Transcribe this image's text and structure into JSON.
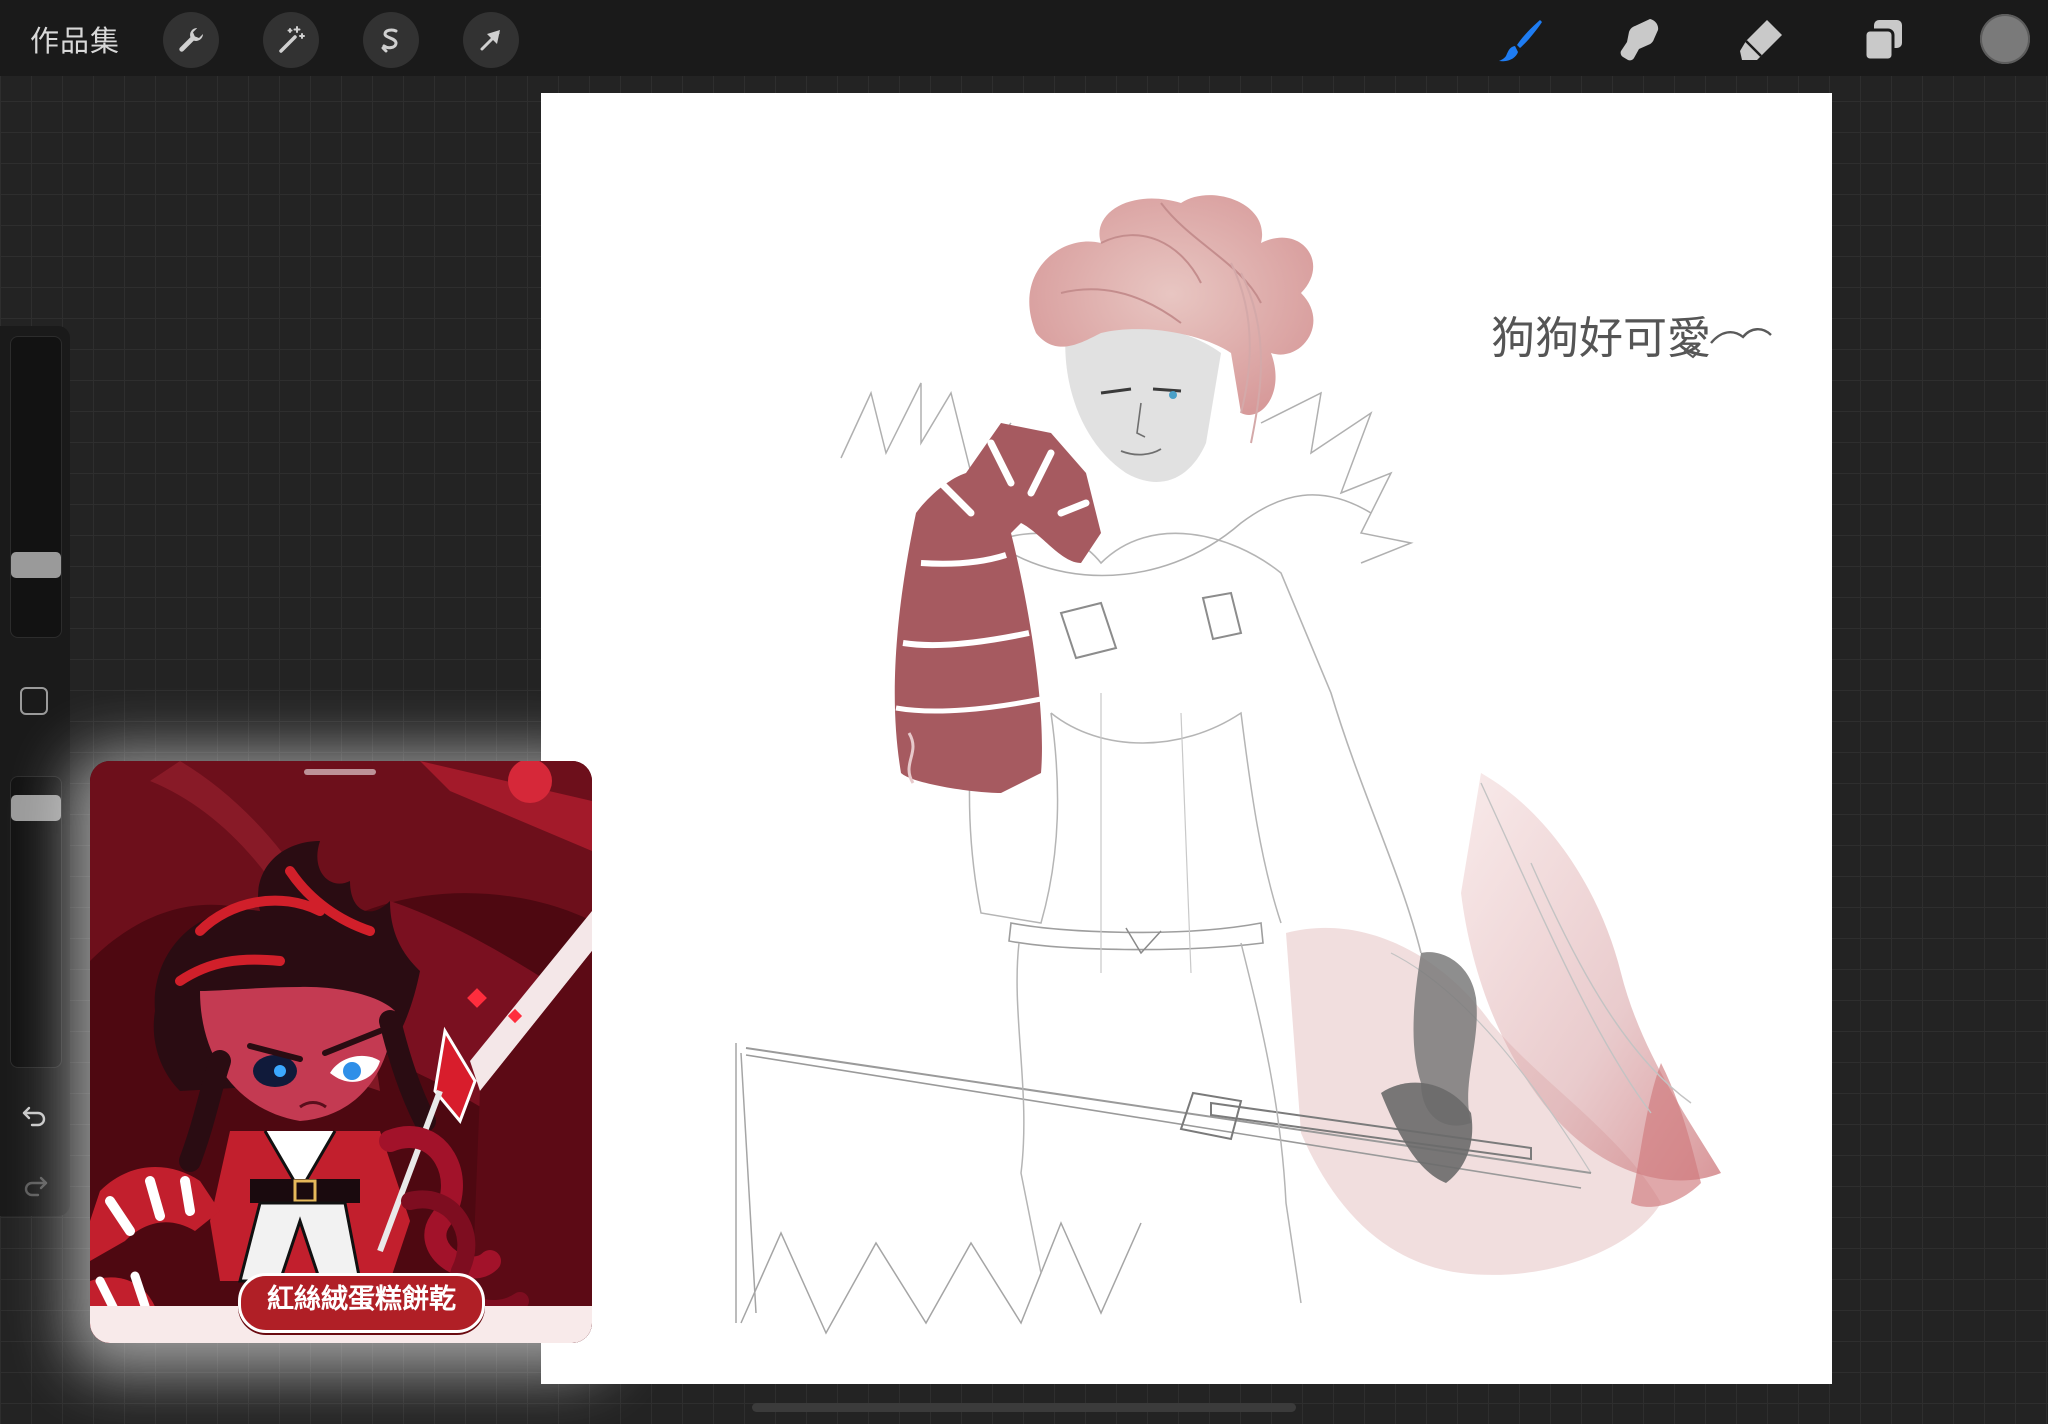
{
  "topbar": {
    "gallery_label": "作品集",
    "left_tools": [
      {
        "name": "actions",
        "icon": "wrench-icon"
      },
      {
        "name": "adjustments",
        "icon": "magic-wand-icon"
      },
      {
        "name": "selection",
        "icon": "selection-s-icon"
      },
      {
        "name": "transform",
        "icon": "arrow-cursor-icon"
      }
    ],
    "right_tools": [
      {
        "name": "paint",
        "icon": "brush-icon",
        "active": true
      },
      {
        "name": "smudge",
        "icon": "smudge-finger-icon",
        "active": false
      },
      {
        "name": "erase",
        "icon": "eraser-icon",
        "active": false
      },
      {
        "name": "layers",
        "icon": "layers-icon",
        "active": false
      }
    ],
    "active_tool_color": "#1e7cf2",
    "current_color": "#7a7a7a"
  },
  "sidebar": {
    "brush_size_level": 0.25,
    "brush_opacity_level": 0.9,
    "undo_icon": "undo-icon",
    "redo_icon": "redo-icon"
  },
  "canvas": {
    "signature": "狗狗好可愛"
  },
  "reference": {
    "caption": "紅絲絨蛋糕餅乾",
    "accent_color": "#b01f26"
  }
}
